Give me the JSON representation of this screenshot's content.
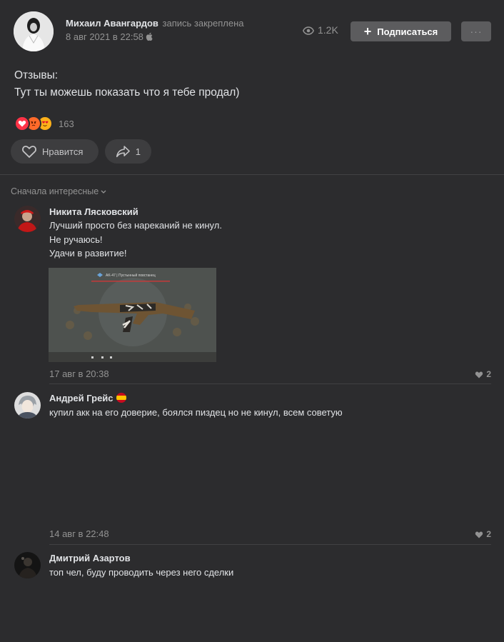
{
  "post": {
    "author": "Михаил Авангардов",
    "pinned_label": "запись закреплена",
    "date": "8 авг 2021 в 22:58",
    "views": "1.2K",
    "subscribe_label": "Подписаться",
    "more_label": "···",
    "text_lines": [
      "Отзывы:",
      "Тут ты можешь показать что я тебе продал)"
    ],
    "reactions_count": "163",
    "like_label": "Нравится",
    "share_count": "1"
  },
  "comments_section": {
    "sort_label": "Сначала интересные"
  },
  "comments": [
    {
      "author": "Никита Лясковский",
      "lines": [
        "Лучший просто без нареканий не кинул.",
        "Не ручаюсь!",
        "Удачи в развитие!"
      ],
      "date": "17 авг в 20:38",
      "likes": "2",
      "attachment_caption": "AK-47 | Пустынный повстанец"
    },
    {
      "author": "Андрей Грейс",
      "lines": [
        "купил акк на его доверие, боялся пиздец но не кинул, всем советую"
      ],
      "date": "14 авг в 22:48",
      "likes": "2"
    },
    {
      "author": "Дмитрий Азартов",
      "lines": [
        "топ чел, буду проводить через него сделки"
      ]
    }
  ],
  "colors": {
    "background": "#2c2c2e",
    "button": "#5c5c5e",
    "pill": "#3d3d3f",
    "muted_text": "#939393",
    "text": "#e1e3e6"
  },
  "icons": [
    "eye-icon",
    "apple-icon",
    "plus-icon",
    "more-icon",
    "heart-icon",
    "share-arrow-icon",
    "chevron-down-icon",
    "spain-flag-icon"
  ]
}
